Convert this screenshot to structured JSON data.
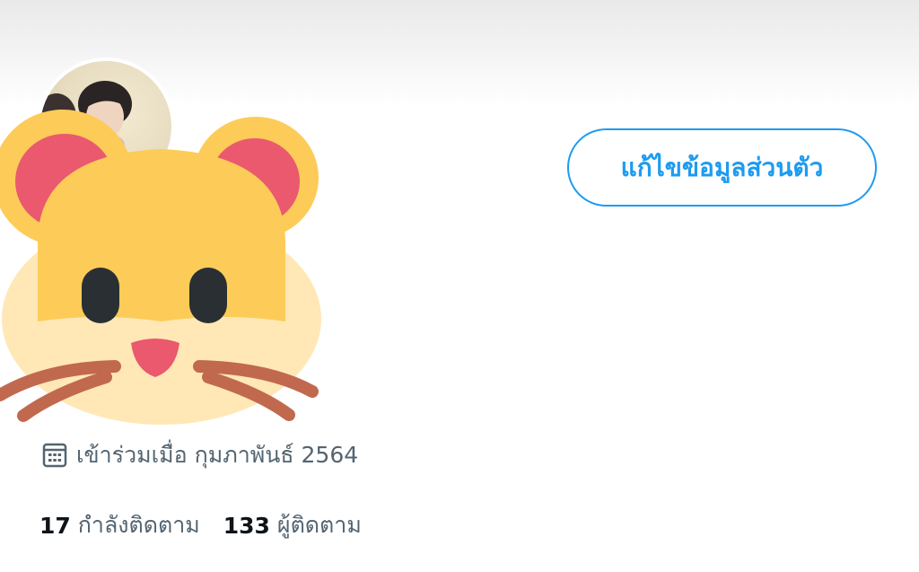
{
  "profile": {
    "edit_button_label": "แก้ไขข้อมูลส่วนตัว",
    "joined_text": "เข้าร่วมเมื่อ กุมภาพันธ์ 2564",
    "following": {
      "count": "17",
      "label": "กำลังติดตาม"
    },
    "followers": {
      "count": "133",
      "label": "ผู้ติดตาม"
    }
  },
  "icons": {
    "calendar": "calendar-icon",
    "overlay": "hamster-icon"
  },
  "colors": {
    "accent": "#1d9bf0",
    "secondary_text": "#536471",
    "primary_text": "#0f1419",
    "hamster_yellow": "#fdcb58",
    "hamster_ear": "#ea596e",
    "hamster_cream": "#ffe8b6",
    "hamster_whisker": "#c1694f"
  }
}
